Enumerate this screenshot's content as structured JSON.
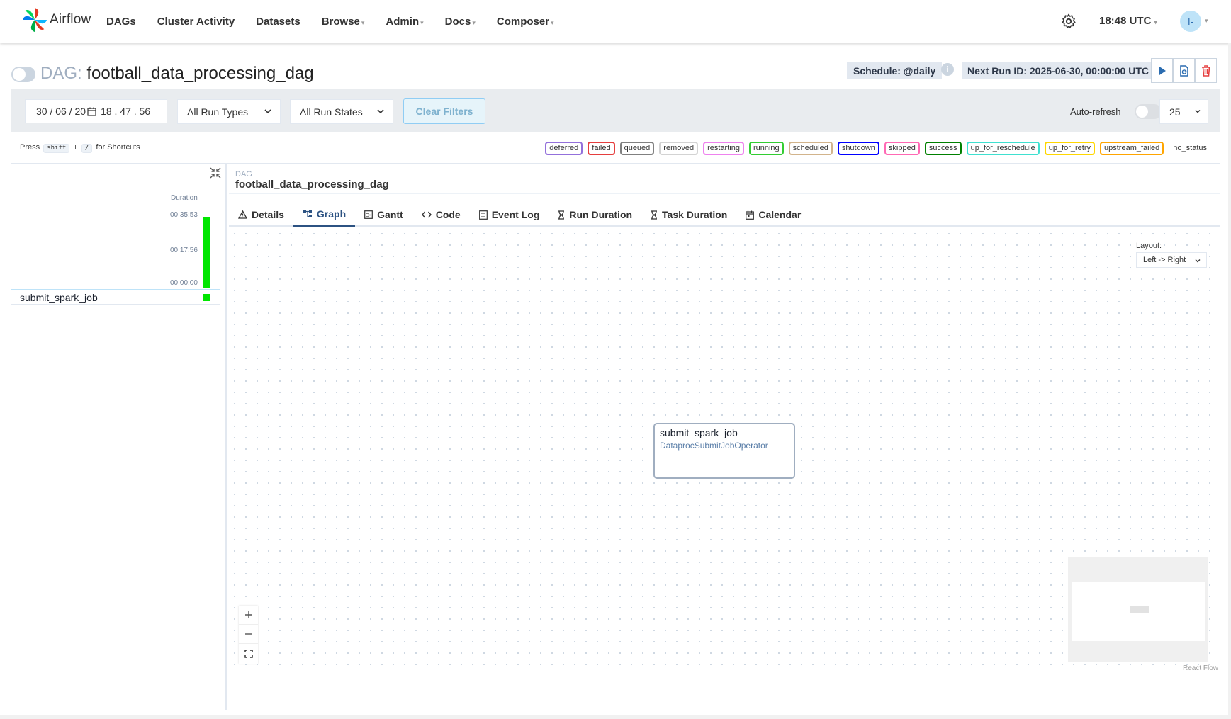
{
  "header": {
    "brand": "Airflow",
    "nav": [
      {
        "label": "DAGs"
      },
      {
        "label": "Cluster Activity"
      },
      {
        "label": "Datasets"
      },
      {
        "label": "Browse"
      },
      {
        "label": "Admin"
      },
      {
        "label": "Docs"
      },
      {
        "label": "Composer"
      }
    ],
    "clock": "18:48 UTC",
    "avatar_initials": "I-"
  },
  "dag": {
    "prefix": "DAG:",
    "name": "football_data_processing_dag",
    "schedule": "Schedule: @daily",
    "next_run": "Next Run ID: 2025-06-30, 00:00:00 UTC",
    "paused": true
  },
  "filters": {
    "date": "30 / 06 / 20",
    "time": "18 . 47 . 56",
    "run_types": "All Run Types",
    "run_states": "All Run States",
    "clear_label": "Clear Filters",
    "auto_refresh_label": "Auto-refresh",
    "count": "25"
  },
  "shortcut": {
    "press": "Press",
    "key1": "shift",
    "plus": "+",
    "key2": "/",
    "suffix": "for Shortcuts"
  },
  "legend": [
    {
      "label": "deferred",
      "color": "#9370db"
    },
    {
      "label": "failed",
      "color": "#e53e3e"
    },
    {
      "label": "queued",
      "color": "#808080"
    },
    {
      "label": "removed",
      "color": "#d3d3d3"
    },
    {
      "label": "restarting",
      "color": "#ee82ee"
    },
    {
      "label": "running",
      "color": "#32cd32"
    },
    {
      "label": "scheduled",
      "color": "#d2b48c"
    },
    {
      "label": "shutdown",
      "color": "#0000ff"
    },
    {
      "label": "skipped",
      "color": "#ff69b4"
    },
    {
      "label": "success",
      "color": "#008000"
    },
    {
      "label": "up_for_reschedule",
      "color": "#40e0d0"
    },
    {
      "label": "up_for_retry",
      "color": "#ffd700"
    },
    {
      "label": "upstream_failed",
      "color": "#ffa500"
    },
    {
      "label": "no_status",
      "color": "transparent"
    }
  ],
  "grid": {
    "duration_label": "Duration",
    "ticks": [
      "00:35:53",
      "00:17:56",
      "00:00:00"
    ],
    "run_fraction": 1.0,
    "tasks": [
      {
        "name": "submit_spark_job",
        "status_color": "#00e600"
      }
    ]
  },
  "detail": {
    "crumb_label": "DAG",
    "crumb_name": "football_data_processing_dag",
    "tabs": [
      {
        "label": "Details",
        "icon": "warning-icon"
      },
      {
        "label": "Graph",
        "icon": "graph-icon"
      },
      {
        "label": "Gantt",
        "icon": "gantt-icon"
      },
      {
        "label": "Code",
        "icon": "code-icon"
      },
      {
        "label": "Event Log",
        "icon": "event-log-icon"
      },
      {
        "label": "Run Duration",
        "icon": "hourglass-icon"
      },
      {
        "label": "Task Duration",
        "icon": "hourglass-icon"
      },
      {
        "label": "Calendar",
        "icon": "calendar-icon"
      }
    ],
    "active_tab": "Graph"
  },
  "graph": {
    "layout_label": "Layout:",
    "layout_value": "Left -> Right",
    "node": {
      "name": "submit_spark_job",
      "operator": "DataprocSubmitJobOperator"
    },
    "attribution": "React Flow"
  }
}
